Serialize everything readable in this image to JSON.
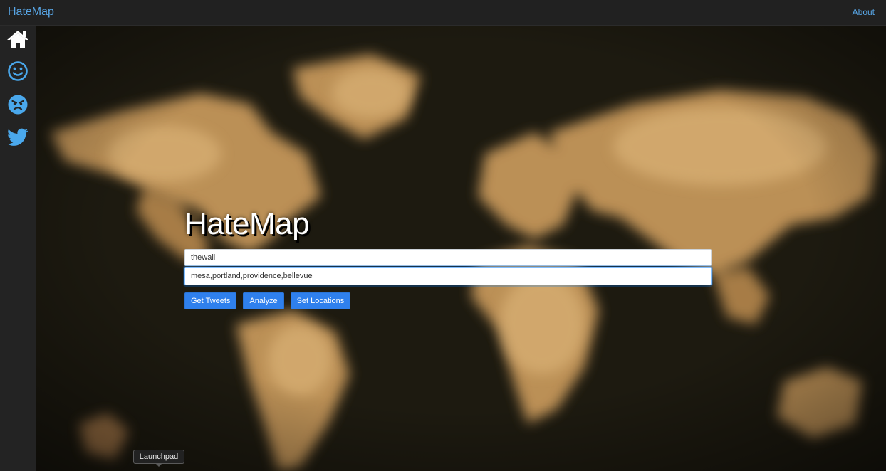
{
  "navbar": {
    "brand": "HateMap",
    "about_label": "About"
  },
  "sidebar": {
    "items": [
      {
        "icon": "home-icon"
      },
      {
        "icon": "smile-icon"
      },
      {
        "icon": "angry-face-icon"
      },
      {
        "icon": "twitter-icon"
      }
    ]
  },
  "hero": {
    "title": "HateMap",
    "search_term": "thewall",
    "locations": "mesa,portland,providence,bellevue",
    "buttons": {
      "get_tweets": "Get Tweets",
      "analyze": "Analyze",
      "set_locations": "Set Locations"
    }
  },
  "dock_tooltip": "Launchpad",
  "colors": {
    "accent": "#58a6e6",
    "button": "#2f80ed",
    "navbar": "#212121",
    "sidebar": "#232323"
  }
}
